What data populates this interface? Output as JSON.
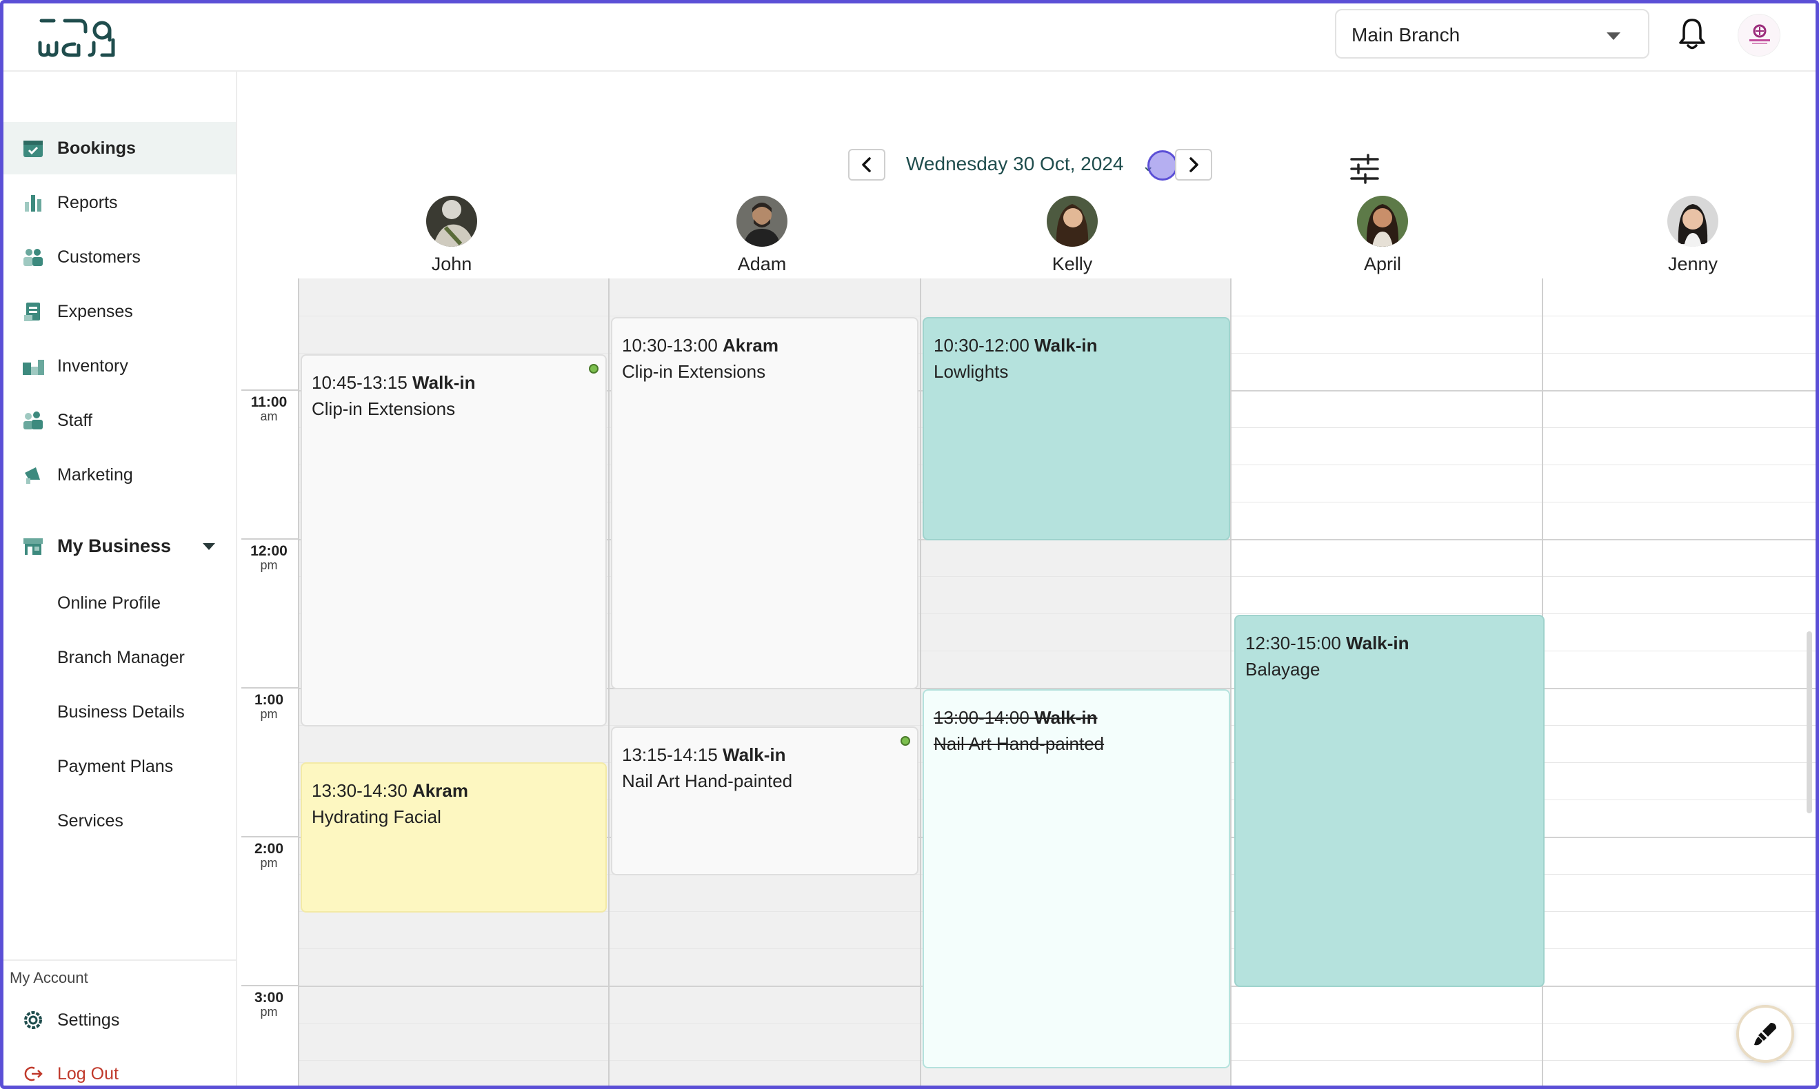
{
  "header": {
    "branch_select": "Main Branch"
  },
  "sidebar": {
    "items": [
      {
        "label": "Bookings",
        "icon": "calendar-check-icon"
      },
      {
        "label": "Reports",
        "icon": "bar-chart-icon"
      },
      {
        "label": "Customers",
        "icon": "users-icon"
      },
      {
        "label": "Expenses",
        "icon": "receipt-icon"
      },
      {
        "label": "Inventory",
        "icon": "boxes-icon"
      },
      {
        "label": "Staff",
        "icon": "staff-icon"
      },
      {
        "label": "Marketing",
        "icon": "megaphone-icon"
      }
    ],
    "business": {
      "label": "My Business",
      "icon": "store-icon",
      "subitems": [
        "Online Profile",
        "Branch Manager",
        "Business Details",
        "Payment Plans",
        "Services"
      ]
    },
    "account_title": "My Account",
    "settings_label": "Settings",
    "logout_label": "Log Out"
  },
  "calendar": {
    "date": "Wednesday 30 Oct, 2024",
    "staff": [
      "John",
      "Adam",
      "Kelly",
      "April",
      "Jenny"
    ],
    "times": [
      {
        "time": "11:00",
        "period": "am"
      },
      {
        "time": "12:00",
        "period": "pm"
      },
      {
        "time": "1:00",
        "period": "pm"
      },
      {
        "time": "2:00",
        "period": "pm"
      },
      {
        "time": "3:00",
        "period": "pm"
      }
    ],
    "appointments": [
      {
        "time": "10:45-13:15",
        "client": "Walk-in",
        "service": "Clip-in Extensions"
      },
      {
        "time": "13:30-14:30",
        "client": "Akram",
        "service": "Hydrating Facial"
      },
      {
        "time": "10:30-13:00",
        "client": "Akram",
        "service": "Clip-in Extensions"
      },
      {
        "time": "13:15-14:15",
        "client": "Walk-in",
        "service": "Nail Art Hand-painted"
      },
      {
        "time": "10:30-12:00",
        "client": "Walk-in",
        "service": "Lowlights"
      },
      {
        "time": "13:00-14:00",
        "client": "Walk-in",
        "service": "Nail Art Hand-painted"
      },
      {
        "time": "12:30-15:00",
        "client": "Walk-in",
        "service": "Balayage"
      }
    ]
  },
  "colors": {
    "brand": "#1f4d4d",
    "teal": "#b5e2dd",
    "yellow": "#fdf7c1",
    "frame": "#5b4fd6"
  }
}
